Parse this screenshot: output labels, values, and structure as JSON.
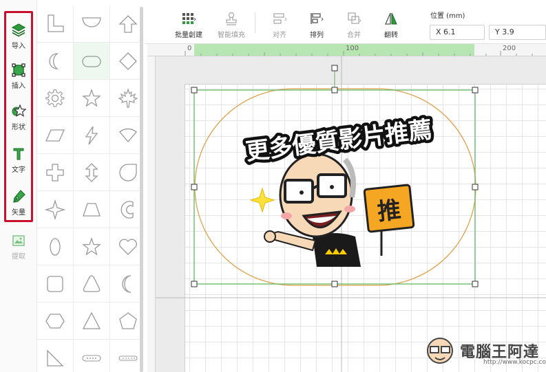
{
  "rail": {
    "items": [
      {
        "label": "导入",
        "icon": "layers-import-icon"
      },
      {
        "label": "插入",
        "icon": "insert-frame-icon"
      },
      {
        "label": "形状",
        "icon": "shapes-star-icon"
      },
      {
        "label": "文字",
        "icon": "text-t-icon"
      },
      {
        "label": "矢量",
        "icon": "pen-vector-icon"
      },
      {
        "label": "提取",
        "icon": "extract-image-icon"
      }
    ],
    "highlight_color": "#c8102e"
  },
  "toolbar": {
    "batch_create": "批量創建",
    "smart_fill": "智能填充",
    "align": "对齐",
    "arrange": "排列",
    "combine": "合并",
    "flip": "翻转",
    "position_label": "位置 (mm)",
    "x_value": "X 6.1",
    "y_value": "Y 3.9"
  },
  "ruler": {
    "labels": [
      "0",
      "100",
      "200"
    ]
  },
  "sticker": {
    "headline": "更多優質影片推薦",
    "sign_text": "推"
  },
  "watermark": {
    "brand": "電腦王阿達",
    "url": "http://www.kocpc.com.tw"
  },
  "colors": {
    "accent_green": "#4caf50",
    "ruler_highlight": "#b7e6b2",
    "outline_orange": "#e0a24a"
  }
}
